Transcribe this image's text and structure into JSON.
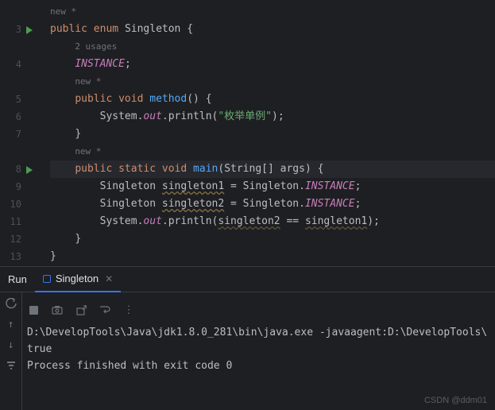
{
  "gutter": {
    "lines": [
      "",
      "3",
      "",
      "4",
      "",
      "5",
      "6",
      "7",
      "",
      "8",
      "9",
      "10",
      "11",
      "12",
      "13"
    ],
    "run_markers": [
      1,
      9
    ]
  },
  "code": {
    "l0_hint": "new *",
    "l1_kw1": "public",
    "l1_kw2": "enum",
    "l1_name": "Singleton",
    "l1_brace": " {",
    "l2_hint": "2 usages",
    "l3_field": "INSTANCE",
    "l3_semi": ";",
    "l4_hint": "new *",
    "l5_kw1": "public",
    "l5_kw2": "void",
    "l5_method": "method",
    "l5_rest": "() {",
    "l6_sys": "System",
    "l6_dot1": ".",
    "l6_out": "out",
    "l6_dot2": ".",
    "l6_println": "println(",
    "l6_str": "\"枚举单例\"",
    "l6_end": ");",
    "l7_brace": "}",
    "l8_hint": "new *",
    "l9_kw1": "public",
    "l9_kw2": "static",
    "l9_kw3": "void",
    "l9_main": "main",
    "l9_paren": "(",
    "l9_type": "String",
    "l9_arr": "[] args) {",
    "l10_type": "Singleton ",
    "l10_var": "singleton1",
    "l10_eq": " = Singleton.",
    "l10_inst": "INSTANCE",
    "l10_semi": ";",
    "l11_type": "Singleton ",
    "l11_var": "singleton2",
    "l11_eq": " = Singleton.",
    "l11_inst": "INSTANCE",
    "l11_semi": ";",
    "l12_sys": "System",
    "l12_dot1": ".",
    "l12_out": "out",
    "l12_dot2": ".",
    "l12_println": "println(",
    "l12_v1": "singleton2",
    "l12_op": " == ",
    "l12_v2": "singleton1",
    "l12_end": ");",
    "l13_brace": "}",
    "l14_brace": "}"
  },
  "toolwindow": {
    "run_label": "Run",
    "tab_name": "Singleton",
    "console": {
      "line1": "D:\\DevelopTools\\Java\\jdk1.8.0_281\\bin\\java.exe -javaagent:D:\\DevelopTools\\",
      "line2": "true",
      "line3": "",
      "line4": "Process finished with exit code 0"
    }
  },
  "watermark": "CSDN @ddm01"
}
